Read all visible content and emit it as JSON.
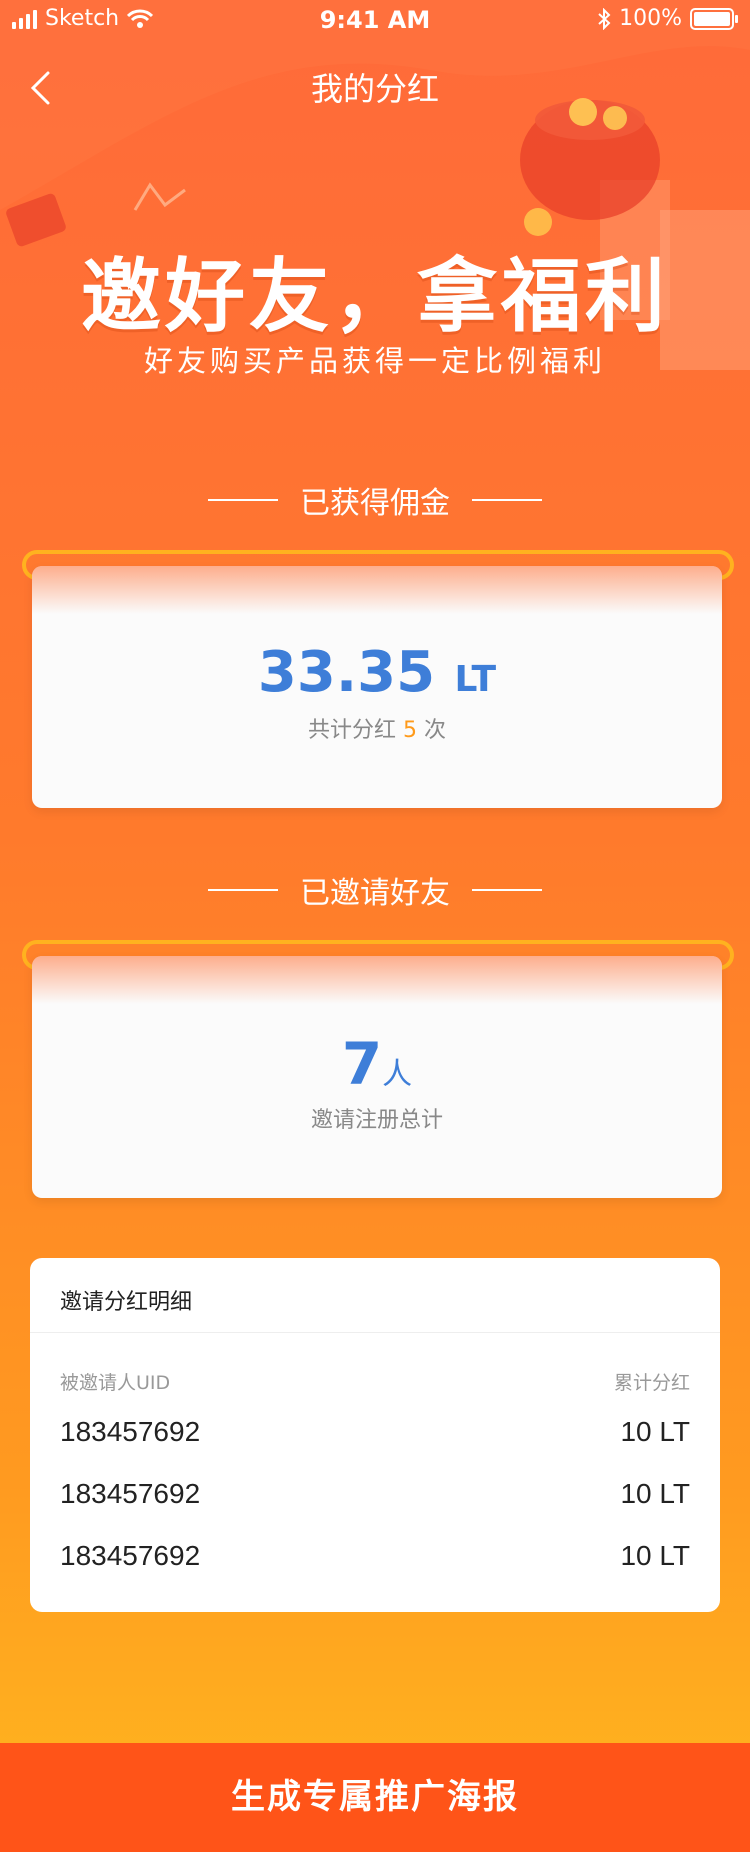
{
  "status_bar": {
    "carrier": "Sketch",
    "time": "9:41 AM",
    "battery": "100%"
  },
  "nav": {
    "title": "我的分红"
  },
  "hero": {
    "title": "邀好友，拿福利",
    "subtitle": "好友购买产品获得一定比例福利"
  },
  "commission": {
    "section_title": "已获得佣金",
    "amount": "33.35",
    "unit": "LT",
    "count_prefix": "共计分红",
    "count": "5",
    "count_suffix": "次"
  },
  "invited": {
    "section_title": "已邀请好友",
    "count": "7",
    "unit": "人",
    "caption": "邀请注册总计"
  },
  "detail": {
    "title": "邀请分红明细",
    "col_uid": "被邀请人UID",
    "col_total": "累计分红",
    "rows": [
      {
        "uid": "183457692",
        "total": "10 LT"
      },
      {
        "uid": "183457692",
        "total": "10 LT"
      },
      {
        "uid": "183457692",
        "total": "10 LT"
      }
    ]
  },
  "bottom_button": {
    "label": "生成专属推广海报"
  },
  "colors": {
    "primary_blue": "#3e7ed8",
    "highlight_orange": "#ff9a1a",
    "button_bg": "#ff5418"
  }
}
